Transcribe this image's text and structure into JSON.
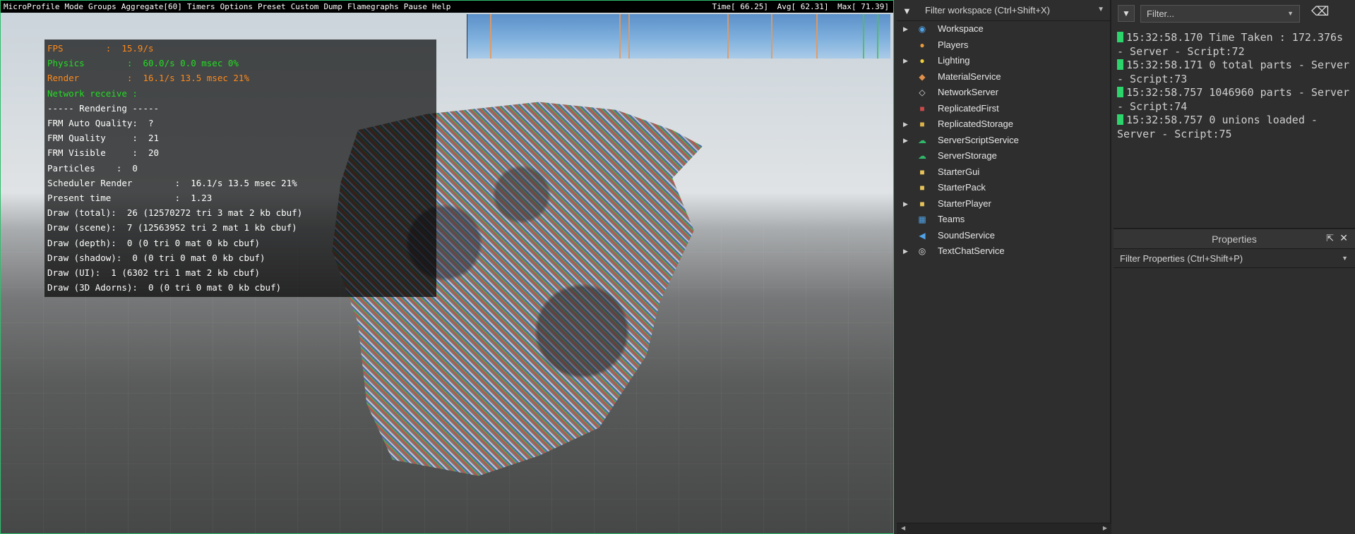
{
  "viewport": {
    "menu": [
      "MicroProfile",
      "Mode",
      "Groups",
      "Aggregate[60]",
      "Timers",
      "Options",
      "Preset",
      "Custom",
      "Dump",
      "Flamegraphs",
      "Pause",
      "Help"
    ],
    "timers": {
      "time": "Time[  66.25]",
      "avg": "Avg[  62.31]",
      "max": "Max[  71.39]"
    },
    "stats": [
      {
        "text": "FPS        :  15.9/s",
        "color": "orange"
      },
      {
        "text": "Physics        :  60.0/s 0.0 msec 0%",
        "color": "green"
      },
      {
        "text": "Render         :  16.1/s 13.5 msec 21%",
        "color": "orange"
      },
      {
        "text": "Network receive :",
        "color": "green"
      },
      {
        "text": "----- Rendering -----",
        "color": "white"
      },
      {
        "text": "FRM Auto Quality:  ?",
        "color": "white"
      },
      {
        "text": "FRM Quality     :  21",
        "color": "white"
      },
      {
        "text": "FRM Visible     :  20",
        "color": "white"
      },
      {
        "text": "Particles    :  0",
        "color": "white"
      },
      {
        "text": "Scheduler Render        :  16.1/s 13.5 msec 21%",
        "color": "white"
      },
      {
        "text": "Present time            :  1.23",
        "color": "white"
      },
      {
        "text": "Draw (total):  26 (12570272 tri 3 mat 2 kb cbuf)",
        "color": "white"
      },
      {
        "text": "Draw (scene):  7 (12563952 tri 2 mat 1 kb cbuf)",
        "color": "white"
      },
      {
        "text": "Draw (depth):  0 (0 tri 0 mat 0 kb cbuf)",
        "color": "white"
      },
      {
        "text": "Draw (shadow):  0 (0 tri 0 mat 0 kb cbuf)",
        "color": "white"
      },
      {
        "text": "Draw (UI):  1 (6302 tri 1 mat 2 kb cbuf)",
        "color": "white"
      },
      {
        "text": "Draw (3D Adorns):  0 (0 tri 0 mat 0 kb cbuf)",
        "color": "white"
      }
    ]
  },
  "explorer": {
    "filter_placeholder": "Filter workspace (Ctrl+Shift+X)",
    "items": [
      {
        "label": "Workspace",
        "expandable": true,
        "icon": "workspace-icon",
        "color": "#4fa3e8",
        "glyph": "◉"
      },
      {
        "label": "Players",
        "expandable": false,
        "icon": "players-icon",
        "color": "#e89a3c",
        "glyph": "●"
      },
      {
        "label": "Lighting",
        "expandable": true,
        "icon": "lightbulb-icon",
        "color": "#f2d13c",
        "glyph": "●"
      },
      {
        "label": "MaterialService",
        "expandable": false,
        "icon": "material-icon",
        "color": "#e0904a",
        "glyph": "◆"
      },
      {
        "label": "NetworkServer",
        "expandable": false,
        "icon": "network-icon",
        "color": "#d8d8d8",
        "glyph": "◇"
      },
      {
        "label": "ReplicatedFirst",
        "expandable": false,
        "icon": "replicated-first-icon",
        "color": "#c94a4a",
        "glyph": "■"
      },
      {
        "label": "ReplicatedStorage",
        "expandable": true,
        "icon": "replicated-storage-icon",
        "color": "#d9b24a",
        "glyph": "■"
      },
      {
        "label": "ServerScriptService",
        "expandable": true,
        "icon": "server-script-icon",
        "color": "#2fb86a",
        "glyph": "☁"
      },
      {
        "label": "ServerStorage",
        "expandable": false,
        "icon": "server-storage-icon",
        "color": "#2fb86a",
        "glyph": "☁"
      },
      {
        "label": "StarterGui",
        "expandable": false,
        "icon": "starter-gui-icon",
        "color": "#e6c35a",
        "glyph": "■"
      },
      {
        "label": "StarterPack",
        "expandable": false,
        "icon": "starter-pack-icon",
        "color": "#e6c35a",
        "glyph": "■"
      },
      {
        "label": "StarterPlayer",
        "expandable": true,
        "icon": "starter-player-icon",
        "color": "#e6c35a",
        "glyph": "■"
      },
      {
        "label": "Teams",
        "expandable": false,
        "icon": "teams-icon",
        "color": "#4fa3e8",
        "glyph": "▦"
      },
      {
        "label": "SoundService",
        "expandable": false,
        "icon": "sound-icon",
        "color": "#4fa3e8",
        "glyph": "◀"
      },
      {
        "label": "TextChatService",
        "expandable": true,
        "icon": "chat-icon",
        "color": "#e0e0e0",
        "glyph": "◎"
      }
    ]
  },
  "output": {
    "filter_placeholder": "Filter...",
    "entries": [
      "15:32:58.170  Time Taken : 172.376s  -  Server - Script:72",
      "15:32:58.171  0 total parts  -  Server - Script:73",
      "15:32:58.757  1046960 parts  -  Server - Script:74",
      "15:32:58.757  0 unions loaded  -  Server - Script:75"
    ]
  },
  "properties": {
    "title": "Properties",
    "filter_placeholder": "Filter Properties (Ctrl+Shift+P)"
  },
  "colors": {
    "accent_green": "#2ebd6b",
    "log_marker": "#2cd46b",
    "stat_orange": "#ff8a1a",
    "stat_green": "#22dd22"
  }
}
